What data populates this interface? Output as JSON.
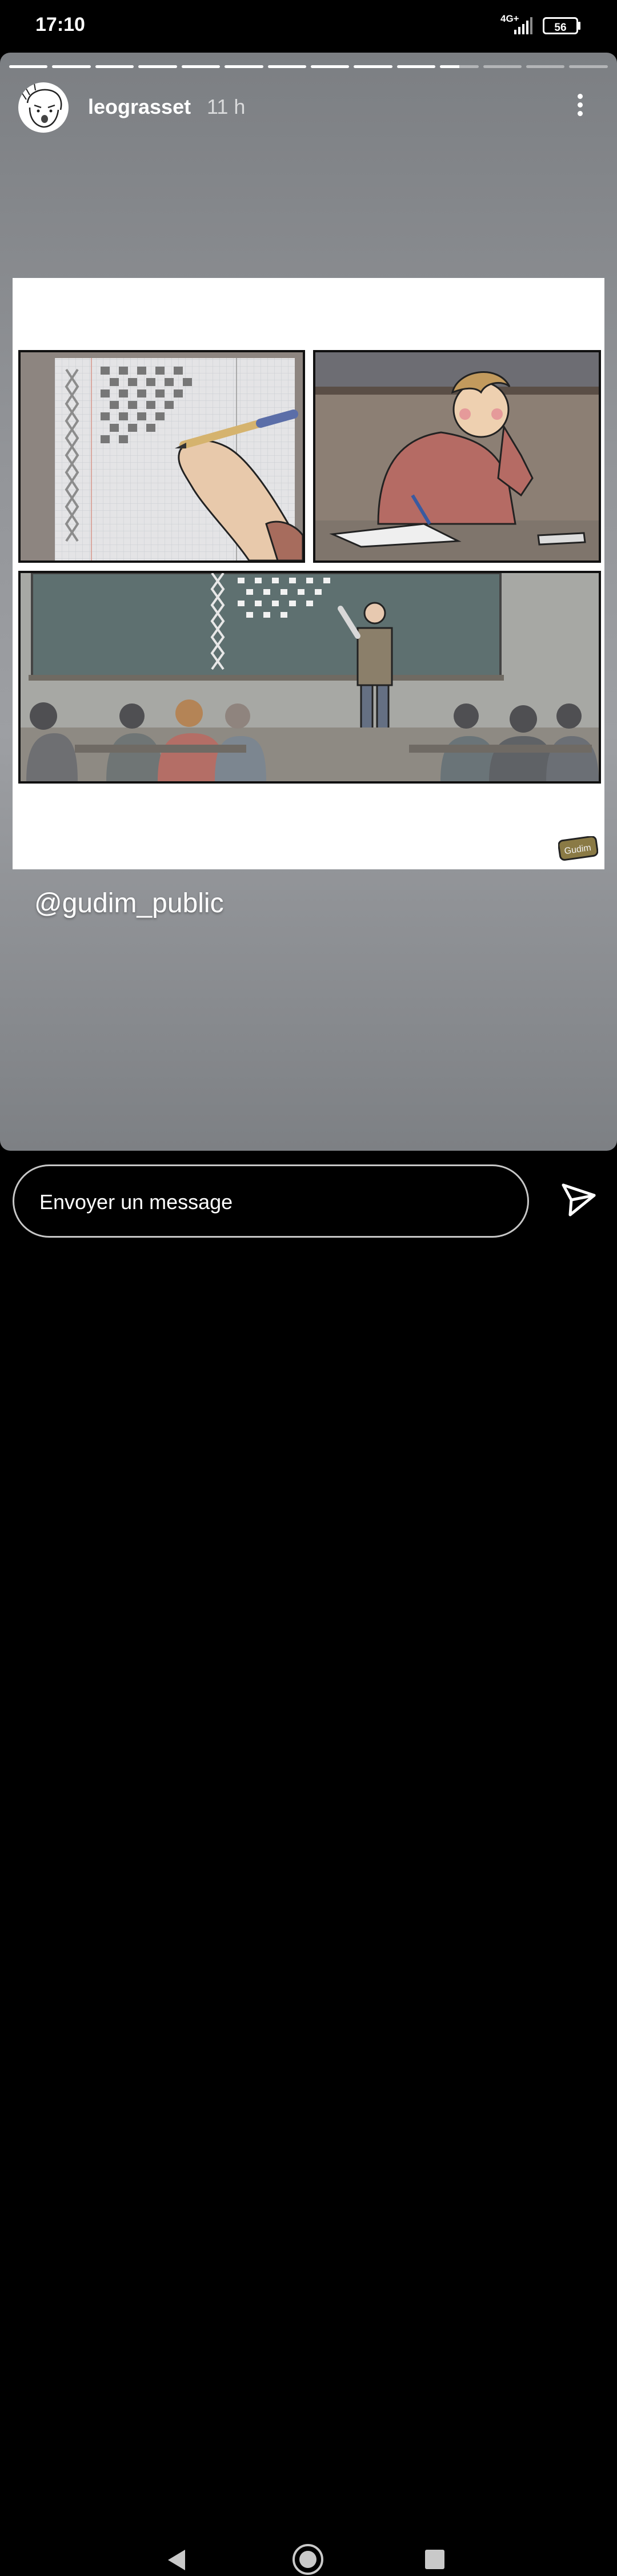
{
  "status_bar": {
    "time": "17:10",
    "network_type": "4G+",
    "battery_level": "56",
    "icons": [
      "signal-icon",
      "battery-icon"
    ]
  },
  "story": {
    "progress_segments": [
      1,
      1,
      1,
      1,
      1,
      1,
      1,
      1,
      1,
      1,
      0.5,
      0,
      0,
      0
    ],
    "username": "leograsset",
    "time_ago": "11 h",
    "mention": "@gudim_public",
    "watermark_text": "Gudim"
  },
  "reply": {
    "placeholder": "Envoyer un message"
  },
  "colors": {
    "background": "#000000",
    "card_top": "#7c7f83",
    "card_bottom": "#7d8084",
    "text": "#ffffff",
    "chalkboard": "#5e7070"
  },
  "icons": {
    "more": "more-vertical-icon",
    "send": "send-icon",
    "back": "back-icon",
    "home": "home-icon",
    "recents": "recents-icon"
  }
}
